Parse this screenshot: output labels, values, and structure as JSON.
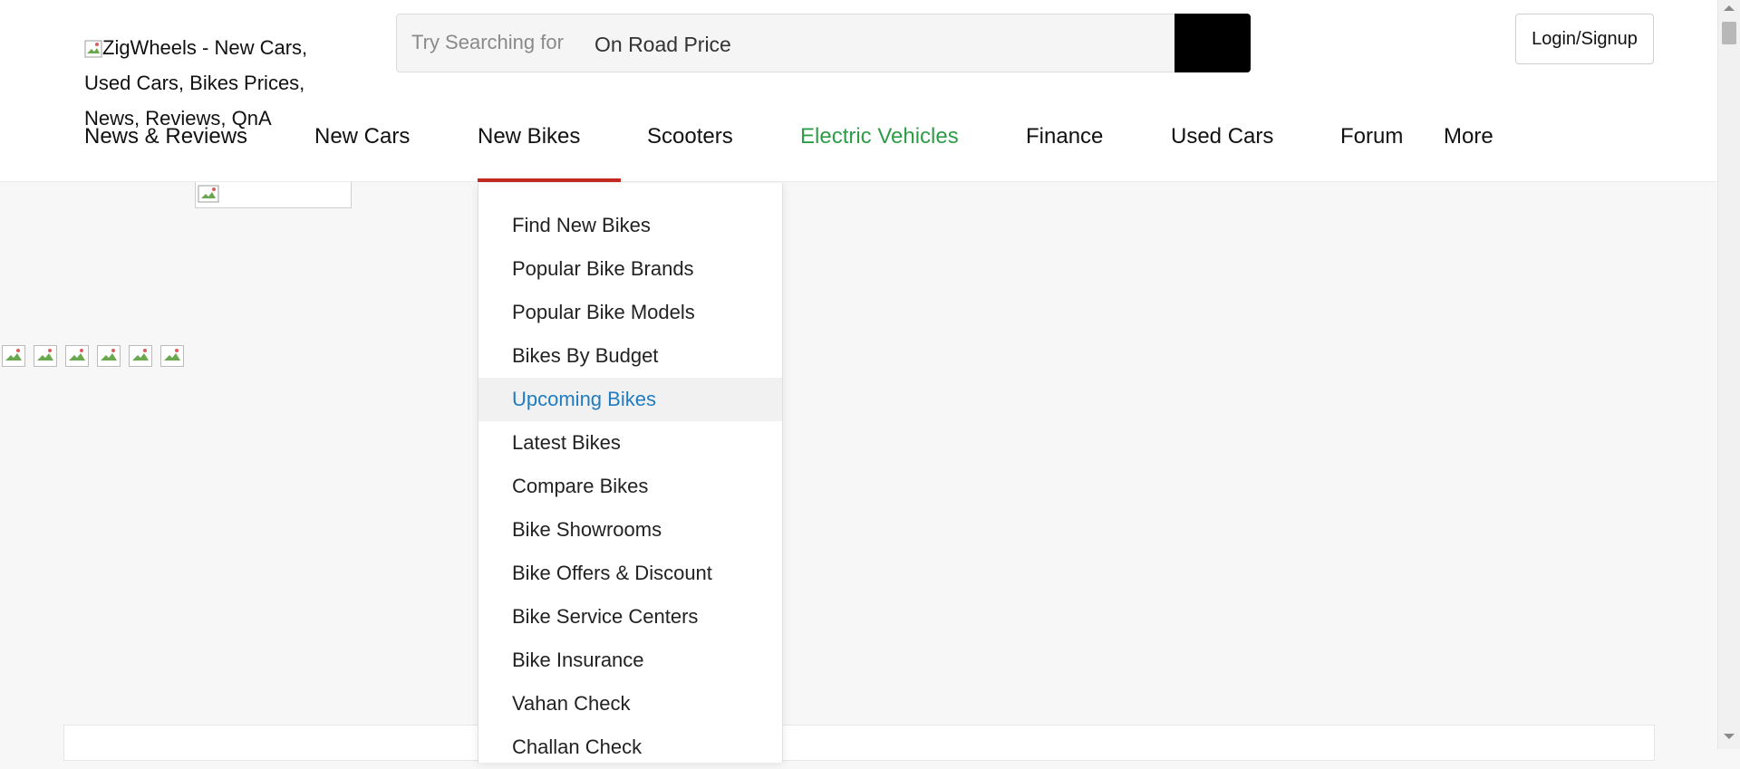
{
  "header": {
    "logo_alt": "ZigWheels - New Cars, Used Cars, Bikes Prices, News, Reviews, QnA",
    "search": {
      "hint": "Try Searching for",
      "value": "On Road Price",
      "search_icon": "search-icon"
    },
    "login_label": "Login/Signup"
  },
  "nav": {
    "items": [
      {
        "label": "News & Reviews"
      },
      {
        "label": "New Cars"
      },
      {
        "label": "New Bikes"
      },
      {
        "label": "Scooters"
      },
      {
        "label": "Electric Vehicles",
        "color": "#2f9d48"
      },
      {
        "label": "Finance"
      },
      {
        "label": "Used Cars"
      },
      {
        "label": "Forum"
      },
      {
        "label": "More"
      }
    ],
    "active_item": "New Bikes",
    "active_color": "#c52a22"
  },
  "dropdown": {
    "items": [
      {
        "label": "Find New Bikes"
      },
      {
        "label": "Popular Bike Brands"
      },
      {
        "label": "Popular Bike Models"
      },
      {
        "label": "Bikes By Budget"
      },
      {
        "label": "Upcoming Bikes",
        "state": "hover",
        "color": "#1f7cc0"
      },
      {
        "label": "Latest Bikes"
      },
      {
        "label": "Compare Bikes"
      },
      {
        "label": "Bike Showrooms"
      },
      {
        "label": "Bike Offers & Discount"
      },
      {
        "label": "Bike Service Centers"
      },
      {
        "label": "Bike Insurance"
      },
      {
        "label": "Vahan Check"
      },
      {
        "label": "Challan Check"
      }
    ]
  },
  "icons": {
    "broken_image": "broken-image-icon"
  }
}
